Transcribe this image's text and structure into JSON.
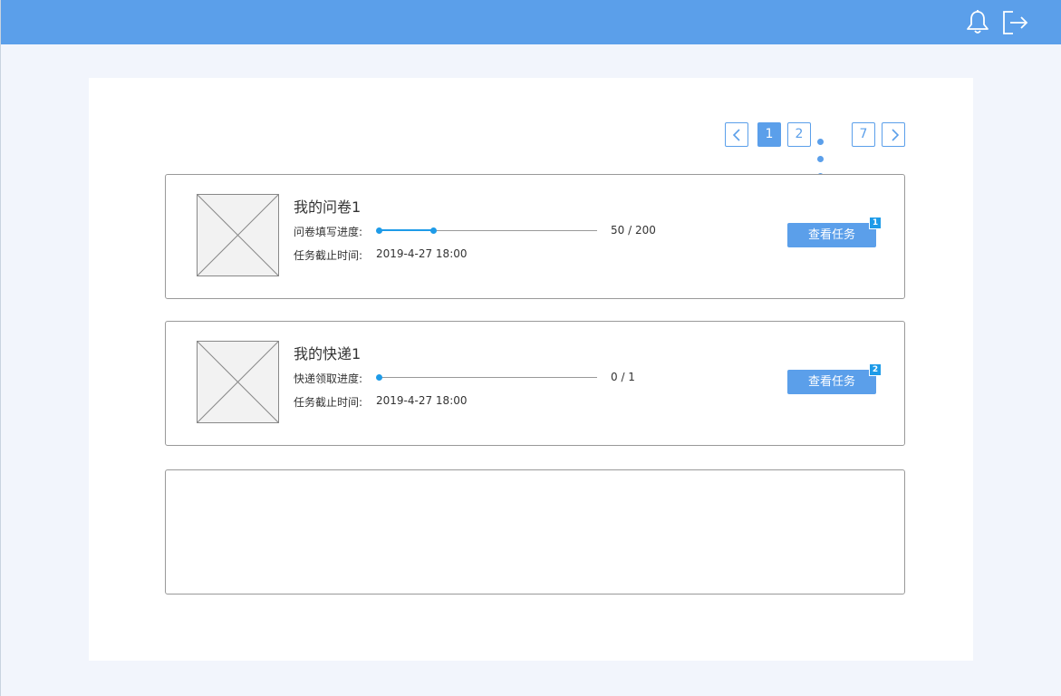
{
  "header": {
    "bell_icon": "bell-icon",
    "logout_icon": "logout-icon",
    "colors": {
      "bar": "#5b9fea"
    }
  },
  "pagination": {
    "prev_icon": "chevron-left-icon",
    "next_icon": "chevron-right-icon",
    "pages": [
      "1",
      "2",
      "7"
    ],
    "current": "1",
    "ellipsis_icon": "ellipsis-dots"
  },
  "tasks": [
    {
      "title": "我的问卷1",
      "progress_label": "问卷填写进度:",
      "progress_fraction": 0.25,
      "progress_text": "50 / 200",
      "deadline_label": "任务截止时间:",
      "deadline_value": "2019-4-27 18:00",
      "button_label": "查看任务",
      "badge": "1"
    },
    {
      "title": "我的快递1",
      "progress_label": "快递领取进度:",
      "progress_fraction": 0,
      "progress_text": "0 / 1",
      "deadline_label": "任务截止时间:",
      "deadline_value": "2019-4-27 18:00",
      "button_label": "查看任务",
      "badge": "2"
    }
  ],
  "colors": {
    "accent": "#5b9fea",
    "progress": "#1e9be8",
    "background": "#f2f5fc"
  }
}
